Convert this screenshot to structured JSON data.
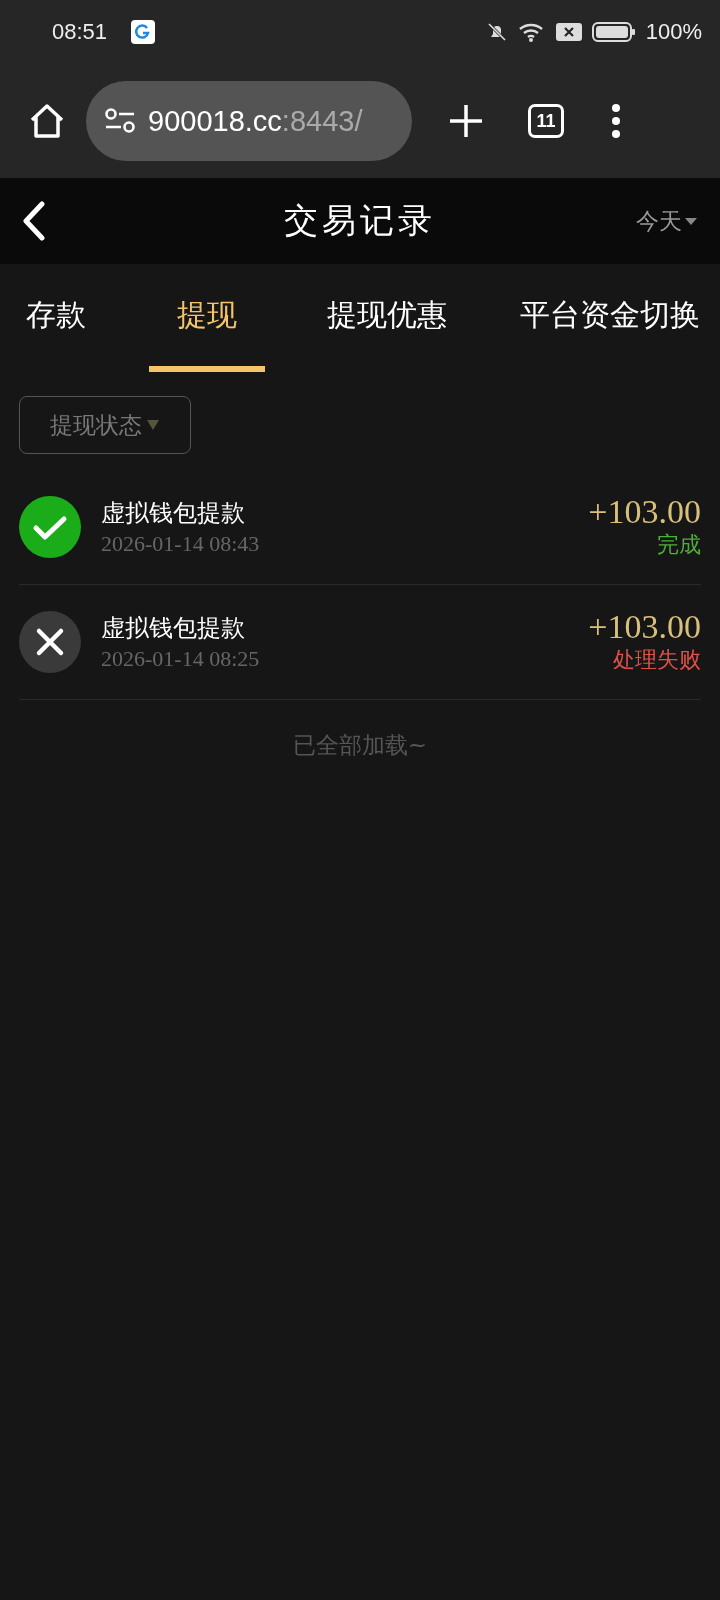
{
  "status_bar": {
    "time": "08:51",
    "battery": "100%"
  },
  "browser": {
    "url_host": "900018.cc",
    "url_rest": ":8443/",
    "tab_count": "11"
  },
  "header": {
    "title": "交易记录",
    "date_filter": "今天"
  },
  "tabs": [
    {
      "label": "存款",
      "selected": false
    },
    {
      "label": "提现",
      "selected": true
    },
    {
      "label": "提现优惠",
      "selected": false
    },
    {
      "label": "平台资金切换",
      "selected": false
    }
  ],
  "filter": {
    "label": "提现状态"
  },
  "records": [
    {
      "title": "虚拟钱包提款",
      "time": "2026-01-14 08:43",
      "amount": "+103.00",
      "status": "完成",
      "kind": "success"
    },
    {
      "title": "虚拟钱包提款",
      "time": "2026-01-14 08:25",
      "amount": "+103.00",
      "status": "处理失败",
      "kind": "failed"
    }
  ],
  "footer": "已全部加载~"
}
